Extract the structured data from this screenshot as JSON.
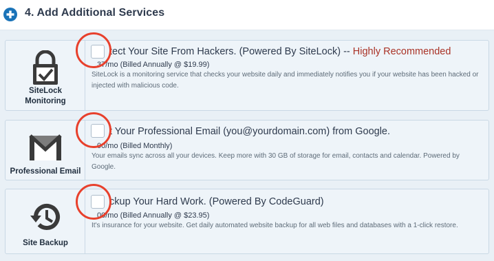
{
  "header": {
    "title": "4. Add Additional Services",
    "icon": "plus-circle-icon",
    "accent": "#1a73b8"
  },
  "services": [
    {
      "label_line1": "SiteLock",
      "label_line2": "Monitoring",
      "icon": "lock-check-icon",
      "title": "tect Your Site From Hackers. (Powered By SiteLock) --",
      "highlight": "Highly Recommended",
      "price": "37/mo (Billed Annually @ $19.99)",
      "description": "SiteLock is a monitoring service that checks your website daily and immediately notifies you if your website has been hacked or injected with malicious code.",
      "checked": false
    },
    {
      "label_line1": "Professional Email",
      "icon": "gmail-envelope-icon",
      "title": "t Your Professional Email (you@yourdomain.com) from Google.",
      "price": "00/mo (Billed Monthly)",
      "description": "Your emails sync across all your devices. Keep more with 30 GB of storage for email, contacts and calendar. Powered by Google.",
      "checked": false
    },
    {
      "label_line1": "Site Backup",
      "icon": "backup-history-icon",
      "title": "ckup Your Hard Work. (Powered By CodeGuard)",
      "price": "00/mo (Billed Annually @ $23.95)",
      "description": "It's insurance for your website. Get daily automated website backup for all web files and databases with a 1-click restore.",
      "checked": false
    }
  ],
  "colors": {
    "highlight": "#a93226",
    "annotation_ring": "#e8402c"
  }
}
